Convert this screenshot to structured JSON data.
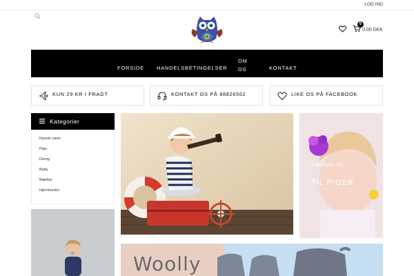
{
  "topbar": {
    "login_label": "LOG IND"
  },
  "header": {
    "logo_icon": "owl-logo-icon",
    "search_icon": "search-icon",
    "wishlist_icon": "heart-icon",
    "cart_icon": "cart-icon",
    "cart_count": "0",
    "cart_total": "0.00 DKK"
  },
  "nav": {
    "items": [
      {
        "label": "FORSIDE"
      },
      {
        "label": "HANDELSBETINGELSER"
      },
      {
        "label": "OM OS"
      },
      {
        "label": "KONTAKT"
      }
    ]
  },
  "features": [
    {
      "icon": "plane-icon",
      "text": "KUN 29 KR I FRAGT"
    },
    {
      "icon": "headset-icon",
      "text": "KONTAKT OS PÅ 88826562"
    },
    {
      "icon": "heart-icon",
      "text": "LIKE OS PÅ FACEBOOK"
    }
  ],
  "sidebar": {
    "title": "Kategorier",
    "items": [
      {
        "label": "Nyeste varer"
      },
      {
        "label": "Pige"
      },
      {
        "label": "Dreng"
      },
      {
        "label": "Baby"
      },
      {
        "label": "Mærker"
      },
      {
        "label": "Hjemmesko"
      }
    ]
  },
  "banners": {
    "right_line1": "Lækkert tøj",
    "right_line2": "TIL PIGER",
    "bottom_text": "Woolly"
  },
  "colors": {
    "nav_bg": "#000000",
    "accent": "#111111",
    "background": "#ffffff"
  }
}
